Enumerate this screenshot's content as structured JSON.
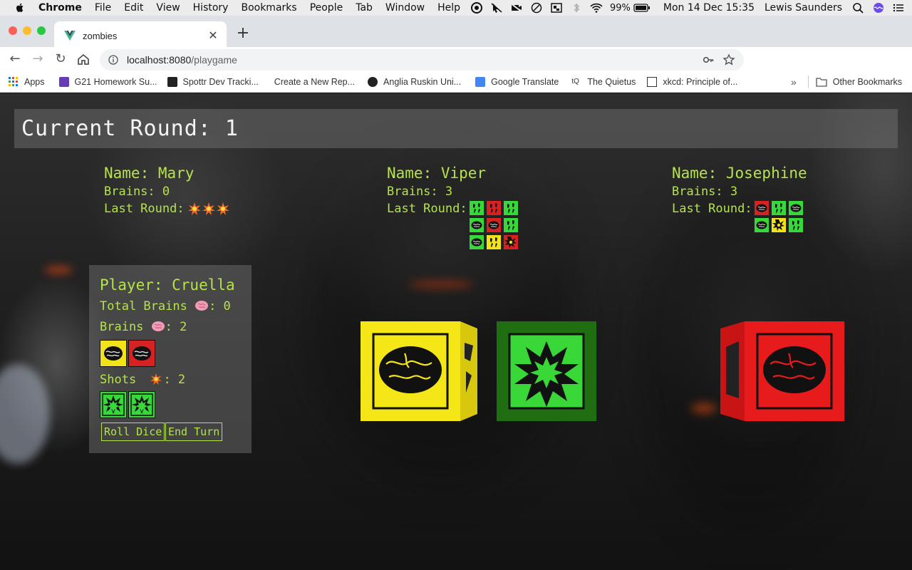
{
  "menubar": {
    "app": "Chrome",
    "items": [
      "File",
      "Edit",
      "View",
      "History",
      "Bookmarks",
      "People",
      "Tab",
      "Window",
      "Help"
    ],
    "battery": "99%",
    "clock": "Mon 14 Dec  15:35",
    "user": "Lewis Saunders"
  },
  "browser": {
    "tab_title": "zombies",
    "url_host": "localhost:8080",
    "url_path": "/playgame",
    "bookmarks": [
      {
        "label": "Apps",
        "icon": "apps-grid-icon"
      },
      {
        "label": "G21 Homework Su...",
        "icon": "forms-icon"
      },
      {
        "label": "Spottr Dev Tracki...",
        "icon": "trello-icon"
      },
      {
        "label": "Create a New Rep...",
        "icon": "github-icon"
      },
      {
        "label": "Anglia Ruskin Uni...",
        "icon": "aru-icon"
      },
      {
        "label": "Google Translate",
        "icon": "translate-icon"
      },
      {
        "label": "The Quietus",
        "icon": "quietus-icon"
      },
      {
        "label": "xkcd: Principle of...",
        "icon": "xkcd-icon"
      }
    ],
    "other_bookmarks": "Other Bookmarks",
    "accent": "#1a73e8"
  },
  "game": {
    "round_label": "Current Round: 1",
    "text_color": "#b6e34a",
    "opponents": [
      {
        "name": "Name: Mary",
        "brains": "Brains: 0",
        "last_round_label": "Last Round:",
        "last_round": "blasts"
      },
      {
        "name": "Name: Viper",
        "brains": "Brains: 3",
        "last_round_label": "Last Round:",
        "last_round": "dice"
      },
      {
        "name": "Name: Josephine",
        "brains": "Brains: 3",
        "last_round_label": "Last Round:",
        "last_round": "dice"
      }
    ],
    "player": {
      "name": "Player: Cruella",
      "total_brains_label": "Total Brains",
      "total_brains_value": ": 0",
      "brains_label": "Brains",
      "brains_value": ": 2",
      "shots_label": "Shots",
      "shots_value": ": 2",
      "roll_button": "Roll Dice",
      "end_button": "End Turn"
    },
    "viper_dice": [
      "green-feet",
      "red-feet",
      "green-feet",
      "green-brain",
      "red-brain",
      "green-feet",
      "green-brain",
      "yellow-feet",
      "red-shot"
    ],
    "josephine_dice": [
      "red-brain",
      "green-feet",
      "green-brain",
      "green-brain",
      "yellow-shot",
      "green-feet"
    ],
    "player_brain_dice": [
      "yellow",
      "red"
    ],
    "player_shot_dice": [
      "green",
      "green"
    ],
    "rolled_dice": [
      {
        "color": "yellow",
        "face": "brain"
      },
      {
        "color": "green",
        "face": "shotgun"
      },
      {
        "color": "red",
        "face": "brain"
      }
    ]
  }
}
